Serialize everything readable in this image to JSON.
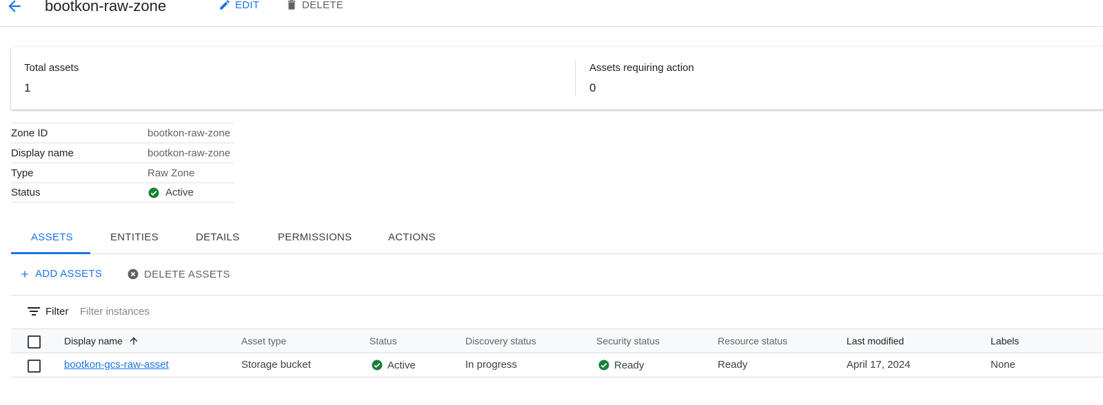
{
  "header": {
    "title": "bootkon-raw-zone",
    "edit_label": "EDIT",
    "delete_label": "DELETE"
  },
  "summary": {
    "total_assets_label": "Total assets",
    "total_assets_value": "1",
    "requiring_action_label": "Assets requiring action",
    "requiring_action_value": "0"
  },
  "properties": [
    {
      "key": "Zone ID",
      "value": "bootkon-raw-zone"
    },
    {
      "key": "Display name",
      "value": "bootkon-raw-zone"
    },
    {
      "key": "Type",
      "value": "Raw Zone"
    },
    {
      "key": "Status",
      "value": "Active"
    }
  ],
  "tabs": [
    "ASSETS",
    "ENTITIES",
    "DETAILS",
    "PERMISSIONS",
    "ACTIONS"
  ],
  "actions": {
    "add_label": "ADD ASSETS",
    "delete_label": "DELETE ASSETS"
  },
  "filter": {
    "label": "Filter",
    "placeholder": "Filter instances",
    "value": ""
  },
  "table": {
    "columns": [
      "Display name",
      "Asset type",
      "Status",
      "Discovery status",
      "Security status",
      "Resource status",
      "Last modified",
      "Labels"
    ],
    "sort_column": "Display name",
    "rows": [
      {
        "display_name": "bootkon-gcs-raw-asset",
        "asset_type": "Storage bucket",
        "status": "Active",
        "discovery_status": "In progress",
        "security_status": "Ready",
        "resource_status": "Ready",
        "last_modified": "April 17, 2024",
        "labels": "None"
      }
    ]
  },
  "colors": {
    "accent": "#1a73e8",
    "success": "#188038",
    "text_primary": "#202124",
    "text_secondary": "#5f6368",
    "divider": "#dadce0"
  }
}
